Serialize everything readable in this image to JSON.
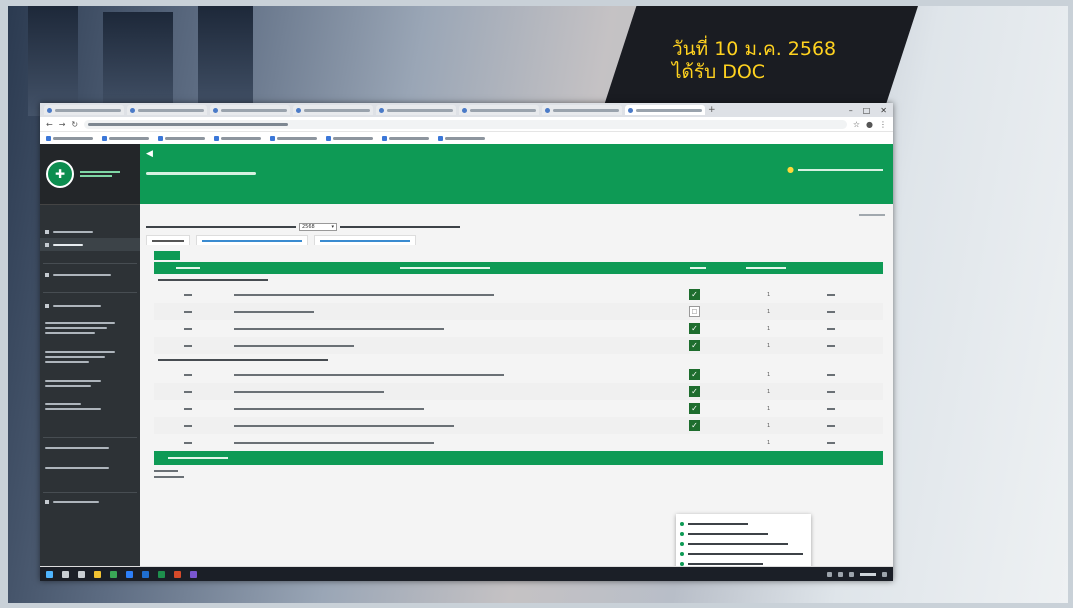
{
  "presentation": {
    "date_line": "วันที่ 10 ม.ค. 2568",
    "sub_line_big": "ได้รับ DOC",
    "sub_line_small": ""
  },
  "browser": {
    "tabs": [
      "",
      "",
      "",
      "",
      "",
      "",
      "",
      ""
    ],
    "url": "",
    "bookmarks": [
      "",
      "",
      "",
      "",
      "",
      "",
      "",
      ""
    ]
  },
  "app": {
    "title": "",
    "user": "",
    "header_text": "",
    "year_select": "2568",
    "page_tabs": [
      "",
      "",
      ""
    ],
    "table": {
      "headers": [
        "",
        "",
        "",
        ""
      ],
      "sections": [
        {
          "label": "",
          "rows": [
            {
              "code": "",
              "desc": "",
              "checked": true,
              "count": "1",
              "amount": ""
            },
            {
              "code": "",
              "desc": "",
              "checked": false,
              "count": "1",
              "amount": ""
            },
            {
              "code": "",
              "desc": "",
              "checked": true,
              "count": "1",
              "amount": ""
            },
            {
              "code": "",
              "desc": "",
              "checked": true,
              "count": "1",
              "amount": ""
            }
          ]
        },
        {
          "label": "",
          "rows": [
            {
              "code": "",
              "desc": "",
              "checked": true,
              "count": "1",
              "amount": ""
            },
            {
              "code": "",
              "desc": "",
              "checked": true,
              "count": "1",
              "amount": ""
            },
            {
              "code": "",
              "desc": "",
              "checked": true,
              "count": "1",
              "amount": ""
            },
            {
              "code": "",
              "desc": "",
              "checked": true,
              "count": "1",
              "amount": ""
            },
            {
              "code": "",
              "desc": "",
              "checked": true,
              "count": "1",
              "amount": ""
            }
          ]
        }
      ],
      "footer": ""
    },
    "popup_items": [
      "",
      "",
      "",
      "",
      ""
    ],
    "copyright": "",
    "version": ""
  },
  "icons": {
    "check": "✓",
    "empty_check": "□"
  },
  "colors": {
    "brand_green": "#0e9a55",
    "sidebar": "#2d3236",
    "date_yellow": "#ffd21f"
  }
}
